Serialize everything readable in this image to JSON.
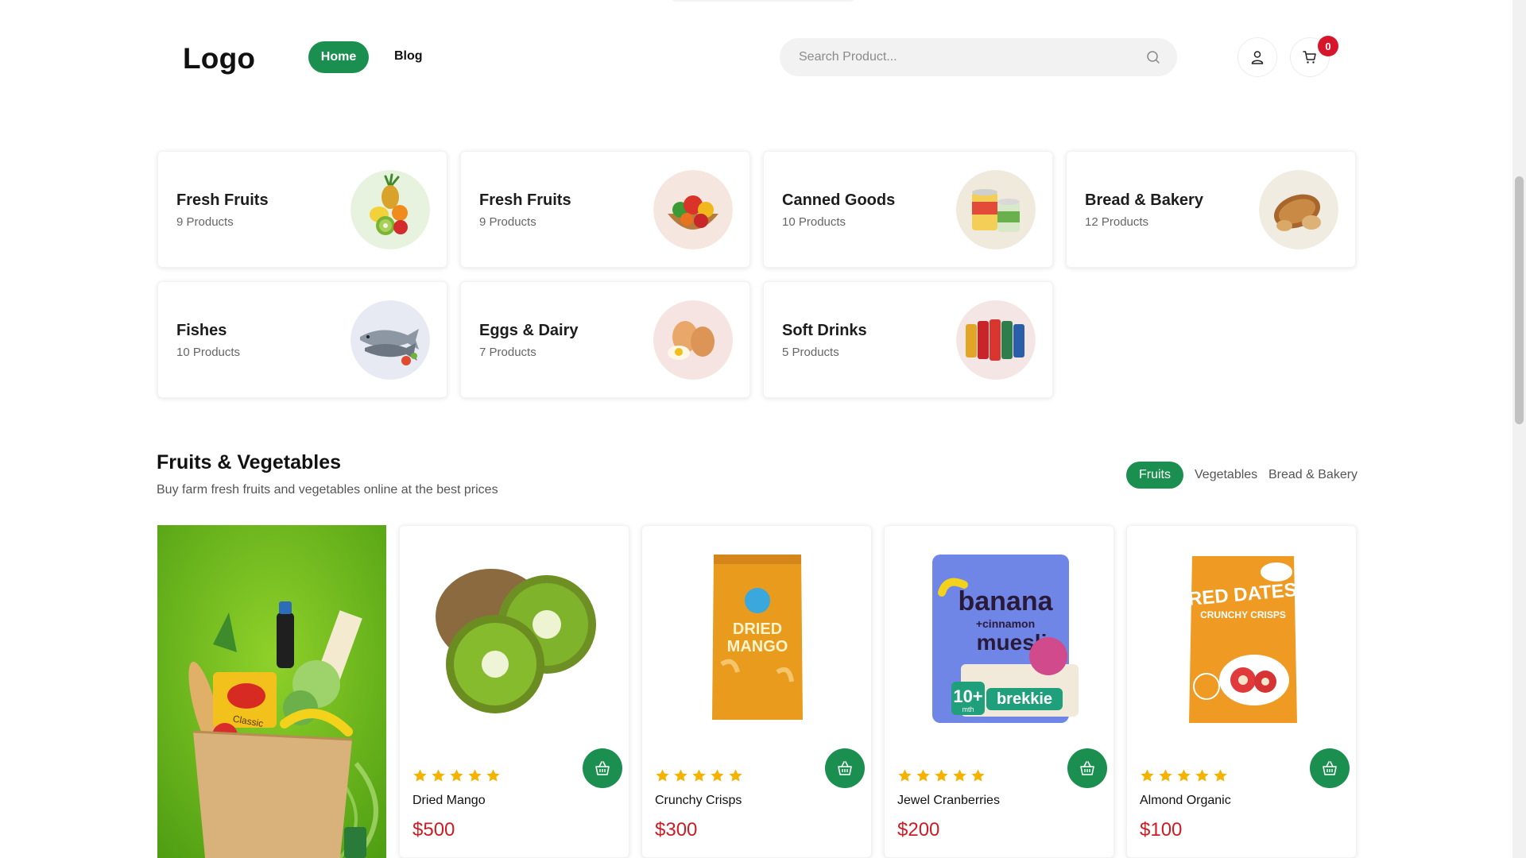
{
  "header": {
    "logo": "Logo",
    "nav": {
      "home": "Home",
      "blog": "Blog"
    },
    "search": {
      "placeholder": "Search Product..."
    },
    "cart": {
      "count": "0"
    }
  },
  "categories": [
    {
      "name": "Fresh Fruits",
      "count": "9 Products"
    },
    {
      "name": "Fresh Fruits",
      "count": "9 Products"
    },
    {
      "name": "Canned Goods",
      "count": "10 Products"
    },
    {
      "name": "Bread & Bakery",
      "count": "12 Products"
    },
    {
      "name": "Fishes",
      "count": "10 Products"
    },
    {
      "name": "Eggs & Dairy",
      "count": "7 Products"
    },
    {
      "name": "Soft Drinks",
      "count": "5 Products"
    }
  ],
  "section": {
    "title": "Fruits & Vegetables",
    "subtitle": "Buy farm fresh fruits and vegetables online at the best prices",
    "tabs": [
      "Fruits",
      "Vegetables",
      "Bread & Bakery"
    ]
  },
  "products": [
    {
      "name": "Dried Mango",
      "price": "$500",
      "rating": 5
    },
    {
      "name": "Crunchy Crisps",
      "price": "$300",
      "rating": 5
    },
    {
      "name": "Jewel Cranberries",
      "price": "$200",
      "rating": 5
    },
    {
      "name": "Almond Organic",
      "price": "$100",
      "rating": 5
    }
  ],
  "package_text": {
    "mango": [
      "DRIED",
      "MANGO"
    ],
    "muesli": [
      "banana",
      "+cinnamon",
      "muesli",
      "10+",
      "mth",
      "brekkie"
    ],
    "dates": [
      "RED DATES",
      "CRUNCHY CRISPS"
    ],
    "banner_bag": "Classic"
  },
  "colors": {
    "primary": "#1a8f4f",
    "price": "#cf1c24",
    "badge": "#d8162b",
    "star": "#f5b301"
  }
}
